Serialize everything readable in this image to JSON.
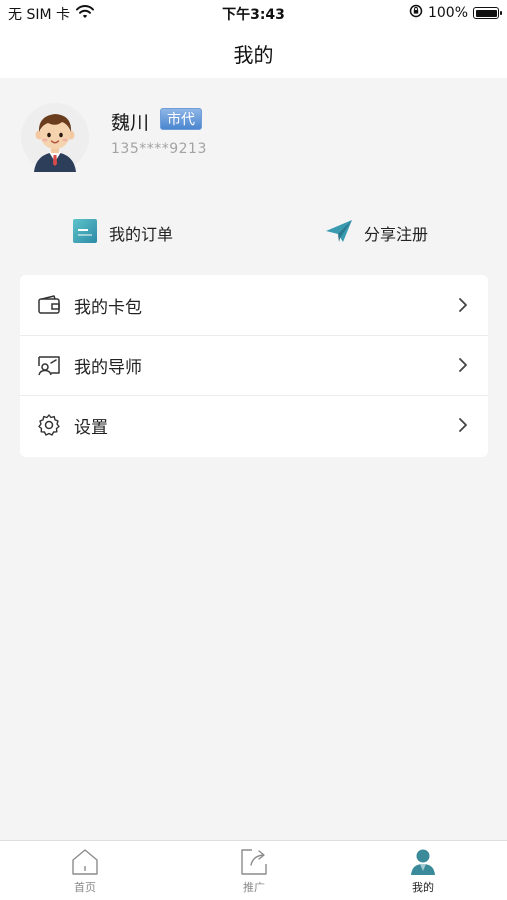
{
  "status_bar": {
    "carrier": "无 SIM 卡",
    "time": "下午3:43",
    "battery": "100%",
    "battery_level": 1.0
  },
  "header": {
    "title": "我的"
  },
  "profile": {
    "name": "魏川",
    "badge": "市代",
    "phone": "135****9213",
    "badge_color": "#4a86cf"
  },
  "quick_actions": {
    "orders": {
      "label": "我的订单",
      "icon": "order-list-icon"
    },
    "share": {
      "label": "分享注册",
      "icon": "paper-plane-icon"
    }
  },
  "menu": {
    "items": [
      {
        "label": "我的卡包",
        "icon": "wallet-icon"
      },
      {
        "label": "我的导师",
        "icon": "mentor-card-icon"
      },
      {
        "label": "设置",
        "icon": "gear-icon"
      }
    ]
  },
  "tab_bar": {
    "tabs": [
      {
        "label": "首页",
        "icon": "home-icon",
        "active": false
      },
      {
        "label": "推广",
        "icon": "share-arrow-icon",
        "active": false
      },
      {
        "label": "我的",
        "icon": "user-icon",
        "active": true
      }
    ],
    "accent_color": "#3a8a9a"
  }
}
